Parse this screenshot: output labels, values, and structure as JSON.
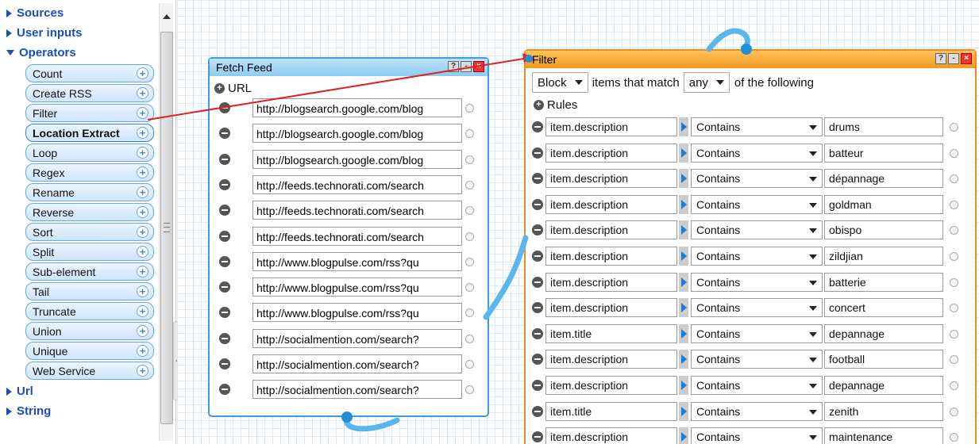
{
  "sidebar": {
    "sections_top": [
      {
        "label": "Sources",
        "expanded": false
      },
      {
        "label": "User inputs",
        "expanded": false
      },
      {
        "label": "Operators",
        "expanded": true
      }
    ],
    "operators": [
      "Count",
      "Create RSS",
      "Filter",
      "Location Extract",
      "Loop",
      "Regex",
      "Rename",
      "Reverse",
      "Sort",
      "Split",
      "Sub-element",
      "Tail",
      "Truncate",
      "Union",
      "Unique",
      "Web Service"
    ],
    "sections_bottom": [
      {
        "label": "Url",
        "expanded": false
      },
      {
        "label": "String",
        "expanded": false
      }
    ],
    "add_glyph": "+"
  },
  "fetch_feed": {
    "title": "Fetch Feed",
    "url_label": "URL",
    "urls": [
      "http://blogsearch.google.com/blog",
      "http://blogsearch.google.com/blog",
      "http://blogsearch.google.com/blog",
      "http://feeds.technorati.com/search",
      "http://feeds.technorati.com/search",
      "http://feeds.technorati.com/search",
      "http://www.blogpulse.com/rss?qu",
      "http://www.blogpulse.com/rss?qu",
      "http://www.blogpulse.com/rss?qu",
      "http://socialmention.com/search?",
      "http://socialmention.com/search?",
      "http://socialmention.com/search?"
    ]
  },
  "filter": {
    "title": "Filter",
    "mode": "Block",
    "items_text": "items that match",
    "match": "any",
    "following_text": "of the following",
    "rules_label": "Rules",
    "rules": [
      {
        "field": "item.description",
        "op": "Contains",
        "value": "drums"
      },
      {
        "field": "item.description",
        "op": "Contains",
        "value": "batteur"
      },
      {
        "field": "item.description",
        "op": "Contains",
        "value": "dépannage"
      },
      {
        "field": "item.description",
        "op": "Contains",
        "value": "goldman"
      },
      {
        "field": "item.description",
        "op": "Contains",
        "value": "obispo"
      },
      {
        "field": "item.description",
        "op": "Contains",
        "value": "zildjian"
      },
      {
        "field": "item.description",
        "op": "Contains",
        "value": "batterie"
      },
      {
        "field": "item.description",
        "op": "Contains",
        "value": "concert"
      },
      {
        "field": "item.title",
        "op": "Contains",
        "value": "depannage"
      },
      {
        "field": "item.description",
        "op": "Contains",
        "value": "football"
      },
      {
        "field": "item.description",
        "op": "Contains",
        "value": "depannage"
      },
      {
        "field": "item.title",
        "op": "Contains",
        "value": "zenith"
      },
      {
        "field": "item.description",
        "op": "Contains",
        "value": "maintenance"
      }
    ]
  },
  "window_buttons": {
    "help": "?",
    "minimize": "-",
    "close": "×"
  },
  "colors": {
    "accent_blue": "#3a9ee0",
    "filter_orange": "#f29a1a",
    "drag_arrow": "#e02020",
    "link_blue": "#1a4fb8"
  }
}
